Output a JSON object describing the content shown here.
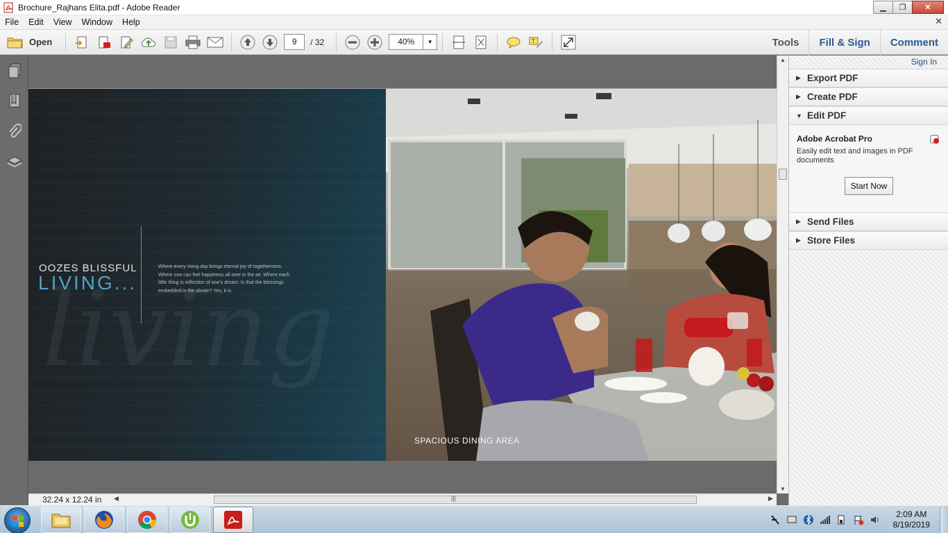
{
  "window": {
    "title": "Brochure_Rajhans Elita.pdf - Adobe Reader",
    "minimize": "▁",
    "restore": "❐",
    "close": "✕"
  },
  "menu": {
    "items": [
      "File",
      "Edit",
      "View",
      "Window",
      "Help"
    ],
    "close": "✕"
  },
  "toolbar": {
    "open_label": "Open",
    "page_current": "9",
    "page_total": "/ 32",
    "zoom": "40%",
    "tabs": [
      "Tools",
      "Fill & Sign",
      "Comment"
    ]
  },
  "document": {
    "left_title": "OOZES BLISSFUL",
    "left_title_big": "LIVING...",
    "left_body": "Where every rising day brings eternal joy of togetherness. Where one can feel happiness all over in the air. Where each little thing is reflection of one's dream. Is that the blessings embedded in the abode? Yes, it is.",
    "left_script": "living",
    "right_caption": "SPACIOUS DINING AREA"
  },
  "status": {
    "page_size": "32.24 x 12.24 in"
  },
  "panel": {
    "signin": "Sign In",
    "sections": [
      "Export PDF",
      "Create PDF",
      "Edit PDF",
      "Send Files",
      "Store Files"
    ],
    "product": "Adobe Acrobat Pro",
    "product_desc": "Easily edit text and images in PDF documents",
    "start_label": "Start Now"
  },
  "taskbar": {
    "apps": [
      "file-explorer",
      "firefox",
      "chrome",
      "utorrent",
      "adobe-reader"
    ],
    "time": "2:09 AM",
    "date": "8/19/2019"
  },
  "colors": {
    "accent_blue": "#2a5b90",
    "living_blue": "#4fa4c4",
    "adobe_red": "#d4201c"
  }
}
